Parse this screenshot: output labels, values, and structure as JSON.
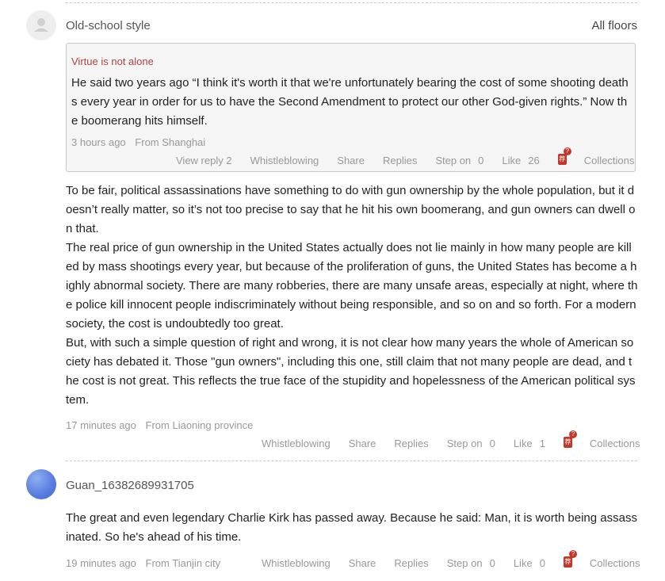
{
  "thread1": {
    "username": "Old-school style",
    "floors_link": "All floors",
    "quote": {
      "author": "Virtue is not alone",
      "text": "He said two years ago “I think it's worth it that we're unfortunately bearing the cost of some shooting deaths every year in order for us to have the Second Amendment to protect our other God-given rights.”  Now the boomerang hits himself.",
      "time": "3 hours ago",
      "location": "From Shanghai",
      "view_reply": "View reply 2",
      "whistleblowing": "Whistleblowing",
      "share": "Share",
      "replies": "Replies",
      "step_on_label": "Step on",
      "step_on_count": "0",
      "like_label": "Like",
      "like_count": "26",
      "collections": "Collections"
    },
    "body": [
      "To be fair, political assassinations have something to do with gun ownership by the whole population, but it doesn’t really matter, so it’s not too precise to say that he hit his own boomerang, and gun owners can dwell on that.",
      "The real price of gun ownership in the United States actually does not lie mainly in how many people are killed by mass shootings every year, but because of the proliferation of guns, the United States has become a highly abnormal society. There are many robberies, there are many unsafe areas, especially at night, where the police kill innocent people indiscriminately without being responsible, and so on and so forth. For a modern society, the cost is undoubtedly too great.",
      "But, with such a simple question of right and wrong, it is not clear how many years the whole of American society has debated it. Those \"gun owners\", including this one, still claim that not many people are dead, and the cost is not great. This reflects the true face of the stupidity and hopelessness of the American political system."
    ],
    "time": "17 minutes ago",
    "location": "From Liaoning province",
    "whistleblowing": "Whistleblowing",
    "share": "Share",
    "replies": "Replies",
    "step_on_label": "Step on",
    "step_on_count": "0",
    "like_label": "Like",
    "like_count": "1",
    "collections": "Collections"
  },
  "thread2": {
    "username": "Guan_16382689931705",
    "body": "The great and even legendary Charlie Kirk has passed away. Because he said: Man, it is worth being assassinated. So he's ahead of his time.",
    "time": "19 minutes ago",
    "location": "From Tianjin city",
    "whistleblowing": "Whistleblowing",
    "share": "Share",
    "replies": "Replies",
    "step_on_label": "Step on",
    "step_on_count": "0",
    "like_label": "Like",
    "like_count": "0",
    "collections": "Collections"
  },
  "icons": {
    "recommend_glyph": "荐",
    "recommend_badge": "?"
  },
  "colors": {
    "accent_red": "#c0392b",
    "quote_author": "#b24040",
    "meta_grey": "#999999"
  }
}
